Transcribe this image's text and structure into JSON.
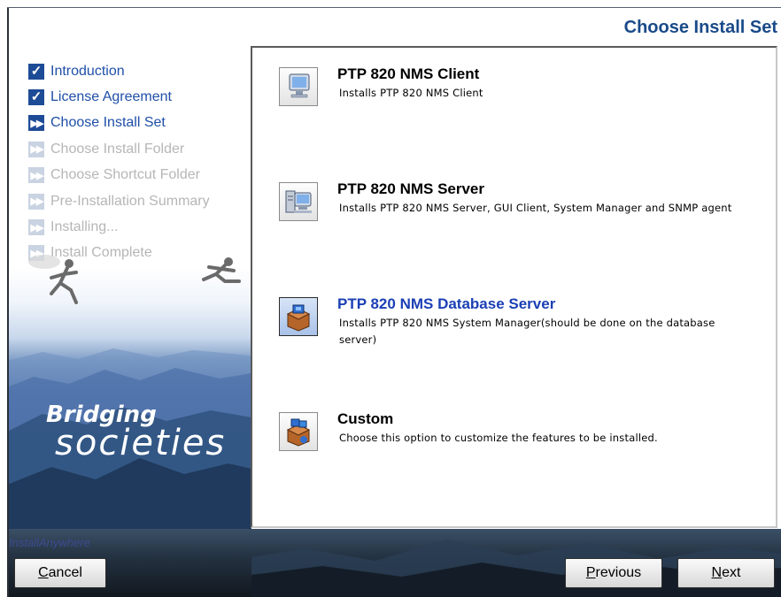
{
  "window": {
    "title": "Choose Install Set"
  },
  "steps": [
    {
      "label": "Introduction",
      "state": "done"
    },
    {
      "label": "License Agreement",
      "state": "done"
    },
    {
      "label": "Choose Install Set",
      "state": "current"
    },
    {
      "label": "Choose Install Folder",
      "state": "pending"
    },
    {
      "label": "Choose Shortcut Folder",
      "state": "pending"
    },
    {
      "label": "Pre-Installation Summary",
      "state": "pending"
    },
    {
      "label": "Installing...",
      "state": "pending"
    },
    {
      "label": "Install Complete",
      "state": "pending"
    }
  ],
  "branding": {
    "line1": "Bridging",
    "line2": "societies",
    "installer": "InstallAnywhere"
  },
  "options": [
    {
      "title": "PTP 820 NMS Client",
      "description": "Installs PTP 820 NMS Client",
      "icon": "monitor-icon",
      "selected": false
    },
    {
      "title": "PTP 820 NMS Server",
      "description": "Installs PTP 820 NMS Server, GUI Client, System Manager and SNMP agent",
      "icon": "server-computer-icon",
      "selected": false
    },
    {
      "title": "PTP 820 NMS Database Server",
      "description": "Installs PTP 820 NMS System Manager(should be done on the database server)",
      "icon": "package-box-icon",
      "selected": true
    },
    {
      "title": "Custom",
      "description": "Choose this option to customize the features to be installed.",
      "icon": "custom-package-icon",
      "selected": false
    }
  ],
  "buttons": {
    "cancel": {
      "mnemonic": "C",
      "rest": "ancel"
    },
    "previous": {
      "mnemonic": "P",
      "rest": "revious"
    },
    "next": {
      "mnemonic": "N",
      "rest": "ext"
    }
  },
  "colors": {
    "accent": "#1f4fa8",
    "selected_title": "#1b3fb5",
    "title": "#1a4a8a"
  }
}
